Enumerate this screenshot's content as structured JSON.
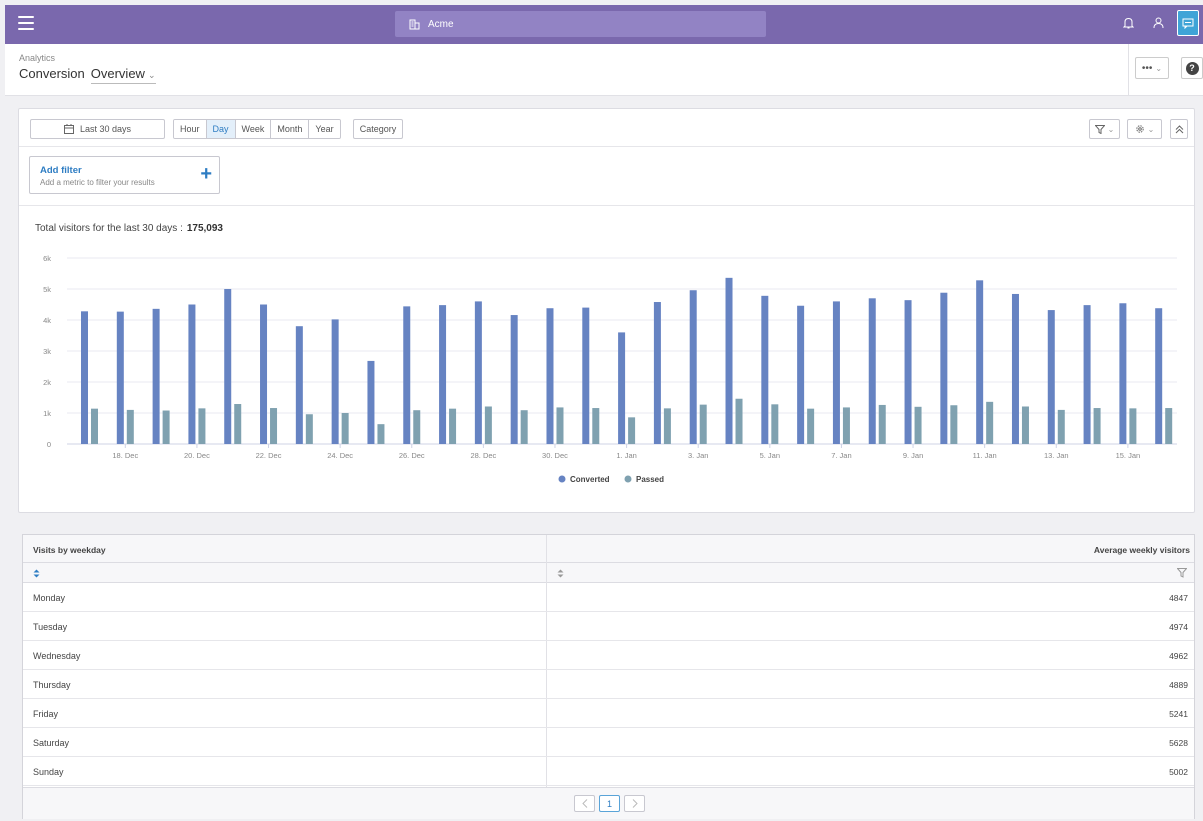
{
  "topbar": {
    "tenant_name": "Acme",
    "accent": "#7a68ad"
  },
  "header": {
    "breadcrumb": "Analytics",
    "title": "Conversion",
    "view": "Overview"
  },
  "toolbar": {
    "date_range": "Last 30 days",
    "granularity": [
      "Hour",
      "Day",
      "Week",
      "Month",
      "Year"
    ],
    "granularity_selected": "Day",
    "category": "Category"
  },
  "filter": {
    "title": "Add filter",
    "subtitle": "Add a metric to filter your results",
    "plus": "+"
  },
  "summary": {
    "label": "Total visitors for the last 30 days :",
    "value": "175,093"
  },
  "chart_data": {
    "type": "bar",
    "categories": [
      "17. Dec",
      "18. Dec",
      "19. Dec",
      "20. Dec",
      "21. Dec",
      "22. Dec",
      "23. Dec",
      "24. Dec",
      "25. Dec",
      "26. Dec",
      "27. Dec",
      "28. Dec",
      "29. Dec",
      "30. Dec",
      "31. Dec",
      "1. Jan",
      "2. Jan",
      "3. Jan",
      "4. Jan",
      "5. Jan",
      "6. Jan",
      "7. Jan",
      "8. Jan",
      "9. Jan",
      "10. Jan",
      "11. Jan",
      "12. Jan",
      "13. Jan",
      "14. Jan",
      "15. Jan",
      "16. Jan"
    ],
    "tick_labels": [
      "18. Dec",
      "20. Dec",
      "22. Dec",
      "24. Dec",
      "26. Dec",
      "28. Dec",
      "30. Dec",
      "1. Jan",
      "3. Jan",
      "5. Jan",
      "7. Jan",
      "9. Jan",
      "11. Jan",
      "13. Jan",
      "15. Jan"
    ],
    "series": [
      {
        "name": "Converted",
        "color": "#6683c2",
        "values": [
          4280,
          4270,
          4360,
          4500,
          5000,
          4500,
          3800,
          4020,
          2680,
          4440,
          4480,
          4600,
          4160,
          4380,
          4400,
          3600,
          4580,
          4960,
          5360,
          4780,
          4460,
          4600,
          4700,
          4640,
          4880,
          5280,
          4840,
          4320,
          4480,
          4540,
          4380
        ]
      },
      {
        "name": "Passed",
        "color": "#7fa1b0",
        "values": [
          1140,
          1100,
          1080,
          1150,
          1290,
          1160,
          960,
          1000,
          640,
          1090,
          1140,
          1210,
          1090,
          1180,
          1160,
          860,
          1150,
          1270,
          1460,
          1280,
          1140,
          1180,
          1260,
          1200,
          1250,
          1360,
          1210,
          1100,
          1160,
          1150,
          1160
        ]
      }
    ],
    "yticks": [
      "0",
      "1k",
      "2k",
      "3k",
      "4k",
      "5k",
      "6k"
    ],
    "ylim": [
      0,
      6000
    ],
    "grid": true,
    "legend": "bottom-center"
  },
  "table": {
    "col1": "Visits by weekday",
    "col2": "Average weekly visitors",
    "rows": [
      {
        "day": "Monday",
        "value": "4847"
      },
      {
        "day": "Tuesday",
        "value": "4974"
      },
      {
        "day": "Wednesday",
        "value": "4962"
      },
      {
        "day": "Thursday",
        "value": "4889"
      },
      {
        "day": "Friday",
        "value": "5241"
      },
      {
        "day": "Saturday",
        "value": "5628"
      },
      {
        "day": "Sunday",
        "value": "5002"
      }
    ],
    "page": "1"
  }
}
